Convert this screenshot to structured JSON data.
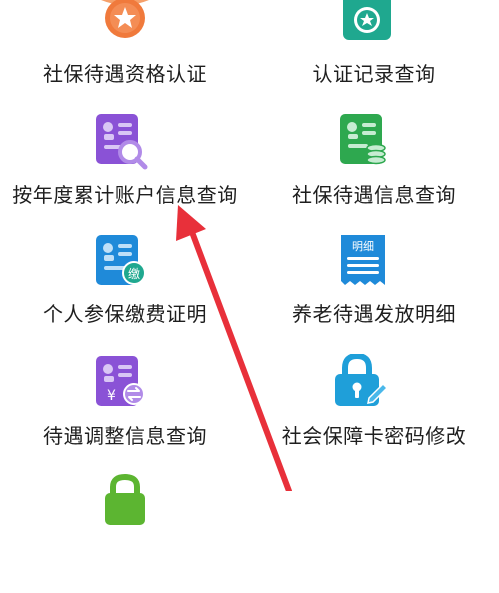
{
  "menu": {
    "items": [
      {
        "label": "社保待遇资格认证",
        "icon": "medal-icon"
      },
      {
        "label": "认证记录查询",
        "icon": "certificate-icon"
      },
      {
        "label": "按年度累计账户信息查询",
        "icon": "id-card-search-icon"
      },
      {
        "label": "社保待遇信息查询",
        "icon": "document-coins-icon"
      },
      {
        "label": "个人参保缴费证明",
        "icon": "id-card-payment-icon"
      },
      {
        "label": "养老待遇发放明细",
        "icon": "receipt-detail-icon"
      },
      {
        "label": "待遇调整信息查询",
        "icon": "id-card-exchange-icon"
      },
      {
        "label": "社会保障卡密码修改",
        "icon": "lock-edit-icon"
      },
      {
        "label": "",
        "icon": "lock-icon"
      }
    ]
  },
  "receipt_badge": "明细",
  "payment_badge": "缴",
  "yen_symbol": "¥",
  "colors": {
    "orange": "#f07a3c",
    "teal": "#1fa88f",
    "purple": "#8a52d6",
    "green": "#2ea84f",
    "blue": "#1f8ad9",
    "annotation_arrow": "#e8303a"
  }
}
